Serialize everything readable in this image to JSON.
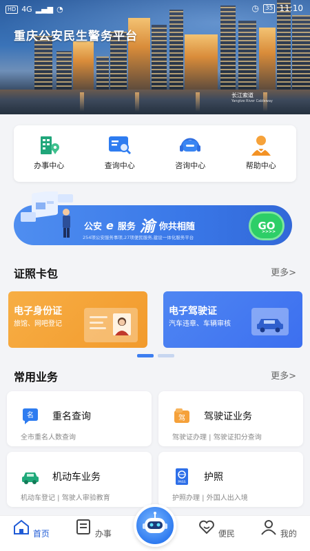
{
  "status_bar": {
    "sim_tag": "HD",
    "network": "4G",
    "battery": "35",
    "time": "11:10"
  },
  "hero": {
    "title": "重庆公安民生警务平台",
    "caption": "长江索道",
    "caption_sub": "Yangtze River Cableway"
  },
  "quick_links": [
    {
      "icon": "building-location-icon",
      "label": "办事中心"
    },
    {
      "icon": "search-card-icon",
      "label": "查询中心"
    },
    {
      "icon": "headset-icon",
      "label": "咨询中心"
    },
    {
      "icon": "person-helper-icon",
      "label": "帮助中心"
    }
  ],
  "banner": {
    "part1": "公安",
    "e": "e",
    "part2": "服务",
    "yu": "渝",
    "part3": "你共相随",
    "subtitle": "254项公安服务事项,27项便民服务,建设一体化服务平台",
    "go": "GO",
    "go_arrows": ">>>>"
  },
  "certificates": {
    "title": "证照卡包",
    "more": "更多>",
    "cards": [
      {
        "title": "电子身份证",
        "desc": "旅馆、网吧登记",
        "color": "#f4a33a"
      },
      {
        "title": "电子驾驶证",
        "desc": "汽车违章、车辆审核",
        "color": "#467af1"
      }
    ]
  },
  "services": {
    "title": "常用业务",
    "more": "更多>",
    "items": [
      {
        "icon": "name-query-icon",
        "badge": "名",
        "name": "重名查询",
        "desc": "全市重名人数查询"
      },
      {
        "icon": "license-folder-icon",
        "badge": "驾",
        "name": "驾驶证业务",
        "desc": "驾驶证办理 | 驾驶证扣分查询"
      },
      {
        "icon": "car-icon",
        "badge": "",
        "name": "机动车业务",
        "desc": "机动车登记 | 驾驶人审验教育"
      },
      {
        "icon": "passport-icon",
        "badge": "PASS",
        "name": "护照",
        "desc": "护照办理 | 外国人出入境"
      }
    ]
  },
  "tabbar": [
    {
      "icon": "home-icon",
      "label": "首页",
      "active": true
    },
    {
      "icon": "list-doc-icon",
      "label": "办事",
      "active": false
    },
    {
      "icon": "robot-icon",
      "label": "",
      "active": false
    },
    {
      "icon": "heart-icon",
      "label": "便民",
      "active": false
    },
    {
      "icon": "user-icon",
      "label": "我的",
      "active": false
    }
  ],
  "colors": {
    "primary": "#3d7ef0",
    "accent_green": "#2dce67",
    "orange": "#f4a33a"
  }
}
